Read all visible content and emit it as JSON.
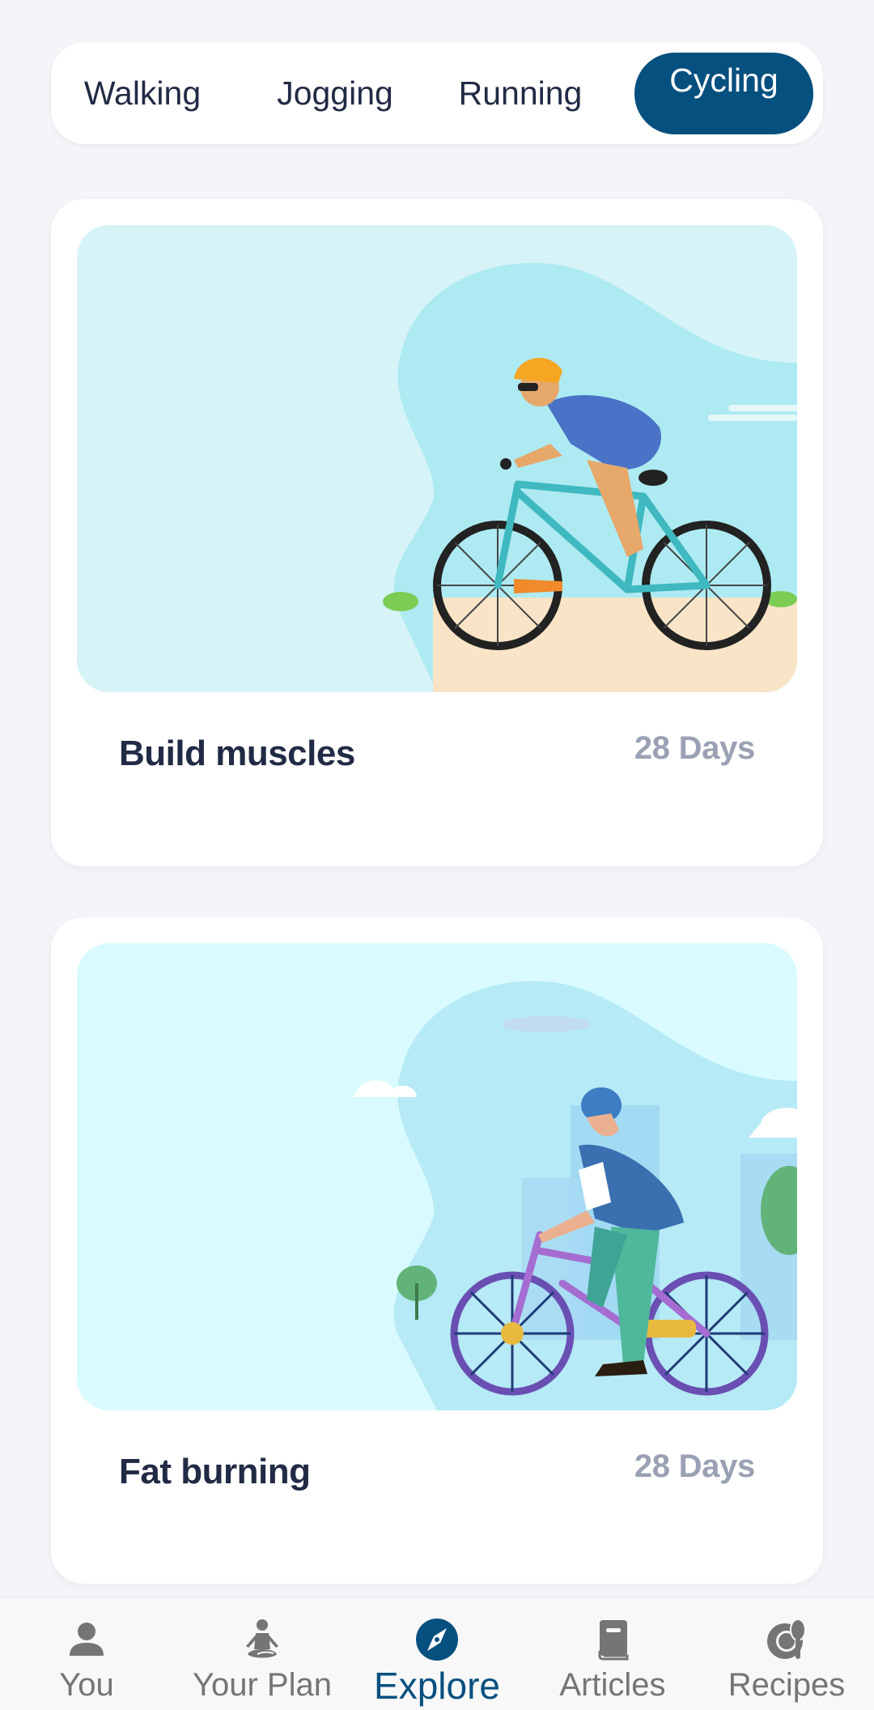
{
  "segments": {
    "items": [
      {
        "label": "Walking",
        "active": false
      },
      {
        "label": "Jogging",
        "active": false
      },
      {
        "label": "Running",
        "active": false
      },
      {
        "label": "Cycling",
        "active": true
      }
    ]
  },
  "cards": [
    {
      "title": "Build muscles",
      "duration": "28 Days",
      "image": "cyclist-road-bike-illustration"
    },
    {
      "title": "Fat burning",
      "duration": "28 Days",
      "image": "cyclist-city-bike-illustration"
    }
  ],
  "bottom_nav": {
    "items": [
      {
        "label": "You",
        "icon": "person-icon",
        "active": false
      },
      {
        "label": "Your Plan",
        "icon": "meditation-icon",
        "active": false
      },
      {
        "label": "Explore",
        "icon": "compass-icon",
        "active": true
      },
      {
        "label": "Articles",
        "icon": "book-icon",
        "active": false
      },
      {
        "label": "Recipes",
        "icon": "plate-spoon-icon",
        "active": false
      }
    ]
  },
  "colors": {
    "accent": "#06507f",
    "background": "#f4f5f8",
    "title_text": "#222b45",
    "muted_text": "#9aa1b4",
    "nav_inactive": "#757575"
  }
}
